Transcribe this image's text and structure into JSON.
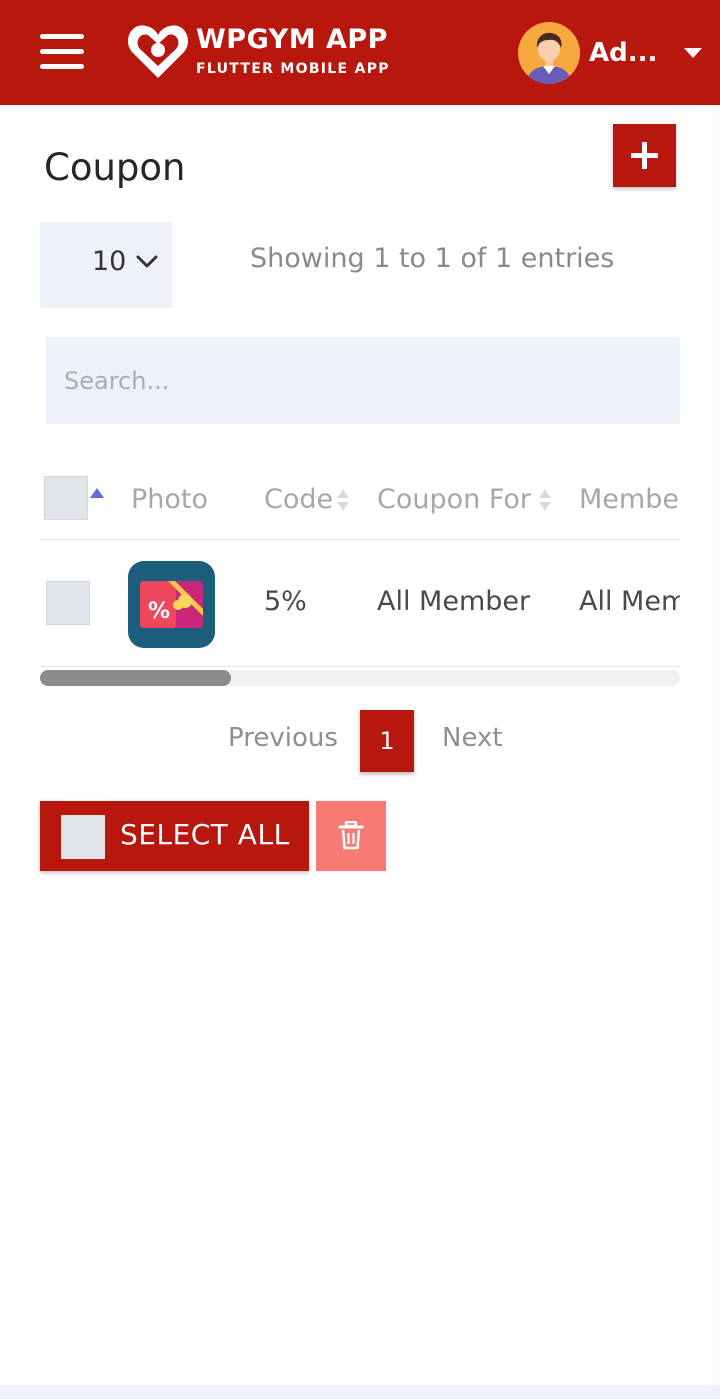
{
  "header": {
    "brand_title": "WPGYM APP",
    "brand_subtitle": "FLUTTER MOBILE APP",
    "user_name": "Ad...",
    "colors": {
      "primary": "#b8170e"
    }
  },
  "page": {
    "title": "Coupon"
  },
  "controls": {
    "page_length": "10",
    "entries_info": "Showing 1 to 1 of 1 entries",
    "search_placeholder": "Search..."
  },
  "table": {
    "columns": [
      "Photo",
      "Code",
      "Coupon For",
      "Member"
    ],
    "rows": [
      {
        "photo_icon": "coupon-percent-icon",
        "code": "5%",
        "coupon_for": "All Member",
        "member": "All Member"
      }
    ]
  },
  "pagination": {
    "previous": "Previous",
    "current": "1",
    "next": "Next"
  },
  "bulk": {
    "select_all": "SELECT ALL",
    "delete_icon": "trash-icon"
  }
}
